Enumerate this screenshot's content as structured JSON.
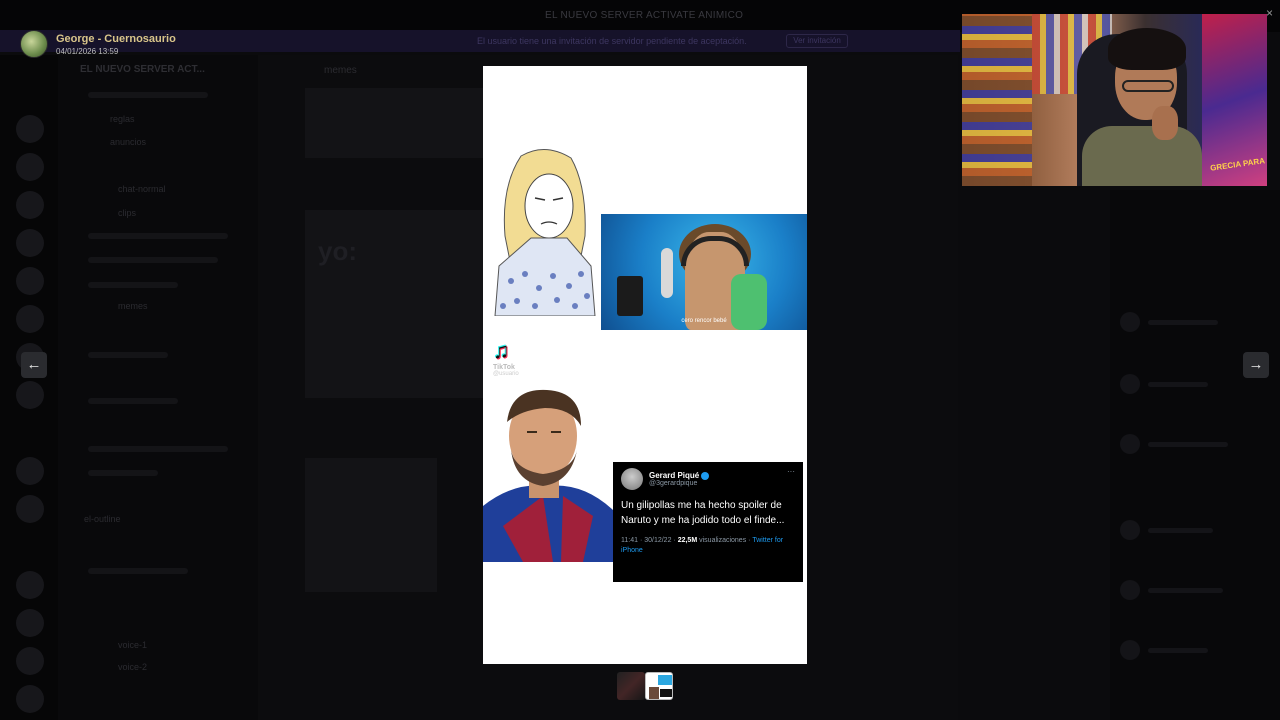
{
  "background": {
    "window_title": "EL NUEVO SERVER ACTIVATE ANIMICO",
    "banner_text": "El usuario tiene una invitación de servidor pendiente de aceptación.",
    "banner_button": "Ver invitación",
    "server_name": "EL NUEVO SERVER ACT...",
    "chat_channel": "memes",
    "meme_text": "yo:",
    "channels": [
      "reglas",
      "anuncios",
      "chat-normal",
      "clips",
      "memes",
      "el-outline",
      "voice-1",
      "voice-2"
    ]
  },
  "viewer": {
    "uploader_name": "George - Cuernosaurio",
    "upload_date": "04/01/2026 13:59",
    "prev_icon": "arrow-left-icon",
    "next_icon": "arrow-right-icon",
    "close_glyph": "×"
  },
  "meme": {
    "singer_caption": "cero rencor bebé",
    "tiktok_label": "TikTok",
    "tiktok_user": "@usuario",
    "tweet": {
      "name": "Gerard Piqué",
      "handle": "@3gerardpique",
      "text": "Un gilipollas me ha hecho spoiler de Naruto y me ha jodido todo el finde...",
      "time": "11:41 · 30/12/22 ·",
      "views": "22,5M",
      "views_label": "visualizaciones ·",
      "source": "Twitter for iPhone"
    }
  },
  "webcam": {
    "poster_text": "GRECIA PARA"
  },
  "colors": {
    "overlay": "#000000",
    "nav_button": "#2a2b2f",
    "uploader": "#d9c58a",
    "twitter_blue": "#1d9bf0"
  }
}
